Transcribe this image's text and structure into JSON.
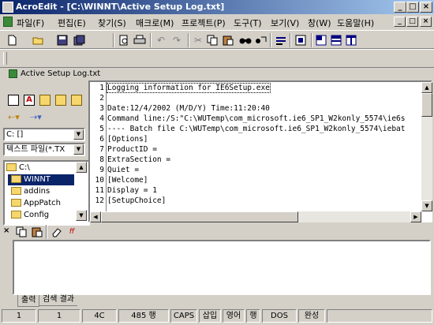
{
  "window": {
    "title": "AcroEdit - [C:\\WINNT\\Active Setup Log.txt]",
    "buttons": [
      "_",
      "□",
      "×"
    ]
  },
  "menu": {
    "items": [
      "파일(F)",
      "편집(E)",
      "찾기(S)",
      "매크로(M)",
      "프로젝트(P)",
      "도구(T)",
      "보기(V)",
      "창(W)",
      "도움말(H)"
    ],
    "mdi_buttons": [
      "_",
      "□",
      "×"
    ]
  },
  "toolbar": {
    "icons": [
      "new-icon",
      "open-icon",
      "save-icon",
      "save-all-icon",
      "print-preview-icon",
      "print-icon",
      "undo-icon",
      "redo-icon",
      "cut-icon",
      "copy-icon",
      "paste-icon",
      "find-icon",
      "replace-icon",
      "wrap-icon",
      "macro-icon",
      "tile-h-icon",
      "tile-icon",
      "tile-v-icon"
    ]
  },
  "document_tab": {
    "label": "Active Setup Log.txt"
  },
  "left_panel": {
    "drive_value": "C: []",
    "filter_value": "텍스트 파일(*.TX",
    "tree": [
      {
        "label": "C:\\",
        "selected": false,
        "indent": 0
      },
      {
        "label": "WINNT",
        "selected": true,
        "indent": 1
      },
      {
        "label": "addins",
        "selected": false,
        "indent": 1
      },
      {
        "label": "AppPatch",
        "selected": false,
        "indent": 1
      },
      {
        "label": "Config",
        "selected": false,
        "indent": 1
      }
    ]
  },
  "editor": {
    "lines": [
      {
        "n": "1",
        "text": "Logging information for IE6Setup.exe"
      },
      {
        "n": "2",
        "text": ""
      },
      {
        "n": "3",
        "text": "Date:12/4/2002 (M/D/Y) Time:11:20:40"
      },
      {
        "n": "4",
        "text": "Command line:/S:\"C:\\WUTemp\\com_microsoft.ie6_SP1_W2konly_5574\\ie6s"
      },
      {
        "n": "5",
        "text": "---- Batch file C:\\WUTemp\\com_microsoft.ie6_SP1_W2konly_5574\\iebat"
      },
      {
        "n": "6",
        "text": "[Options]"
      },
      {
        "n": "7",
        "text": "ProductID ="
      },
      {
        "n": "8",
        "text": "ExtraSection ="
      },
      {
        "n": "9",
        "text": "Quiet ="
      },
      {
        "n": "10",
        "text": "[Welcome]"
      },
      {
        "n": "11",
        "text": "Display = 1"
      },
      {
        "n": "12",
        "text": "[SetupChoice]"
      }
    ]
  },
  "output": {
    "tabs": [
      "출력",
      "검색 결과"
    ]
  },
  "status": {
    "cells": [
      "1",
      "1",
      "4C",
      "485 행",
      "CAPS",
      "삽입",
      "영어",
      "행",
      "DOS",
      "완성"
    ]
  }
}
